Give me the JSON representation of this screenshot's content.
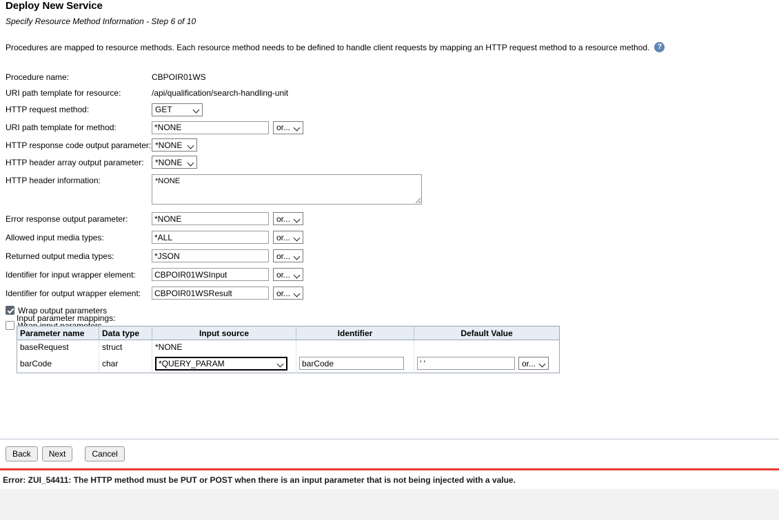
{
  "header": {
    "title": "Deploy New Service",
    "subtitle": "Specify Resource Method Information - Step 6 of 10",
    "intro": "Procedures are mapped to resource methods. Each resource method needs to be defined to handle client requests by mapping an HTTP request method to a resource method.",
    "help_icon": "help-icon",
    "help_glyph": "?"
  },
  "form": {
    "procedure_name_label": "Procedure name:",
    "procedure_name_value": "CBPOIR01WS",
    "uri_resource_label": "URI path template for resource:",
    "uri_resource_value": "/api/qualification/search-handling-unit",
    "http_method_label": "HTTP request method:",
    "http_method_value": "GET",
    "uri_method_label": "URI path template for method:",
    "uri_method_value": "*NONE",
    "uri_method_or": "or...",
    "response_code_label": "HTTP response code output parameter:",
    "response_code_value": "*NONE",
    "header_array_label": "HTTP header array output parameter:",
    "header_array_value": "*NONE",
    "header_info_label": "HTTP header information:",
    "header_info_value": "*NONE",
    "error_response_label": "Error response output parameter:",
    "error_response_value": "*NONE",
    "error_response_or": "or...",
    "allowed_input_label": "Allowed input media types:",
    "allowed_input_value": "*ALL",
    "allowed_input_or": "or...",
    "returned_output_label": "Returned output media types:",
    "returned_output_value": "*JSON",
    "returned_output_or": "or...",
    "input_wrapper_label": "Identifier for input wrapper element:",
    "input_wrapper_value": "CBPOIR01WSInput",
    "input_wrapper_or": "or...",
    "output_wrapper_label": "Identifier for output wrapper element:",
    "output_wrapper_value": "CBPOIR01WSResult",
    "output_wrapper_or": "or...",
    "wrap_output_label": "Wrap output parameters",
    "wrap_output_checked": true,
    "wrap_input_label": "Wrap input parameters",
    "wrap_input_checked": false
  },
  "mappings": {
    "title": "Input parameter mappings:",
    "columns": [
      "Parameter name",
      "Data type",
      "Input source",
      "Identifier",
      "Default Value"
    ],
    "rows": [
      {
        "parameter_name": "baseRequest",
        "data_type": "struct",
        "input_source": "*NONE",
        "identifier": "",
        "default_value": ""
      },
      {
        "parameter_name": "barCode",
        "data_type": "char",
        "input_source": "*QUERY_PARAM",
        "identifier": "barCode",
        "default_value": "' '",
        "default_or": "or..."
      }
    ]
  },
  "footer": {
    "back": "Back",
    "next": "Next",
    "cancel": "Cancel"
  },
  "error": {
    "message": "Error: ZUI_54411: The HTTP method must be PUT or POST when there is an input parameter that is not being injected with a value.",
    "accent_color": "#e8392e"
  }
}
